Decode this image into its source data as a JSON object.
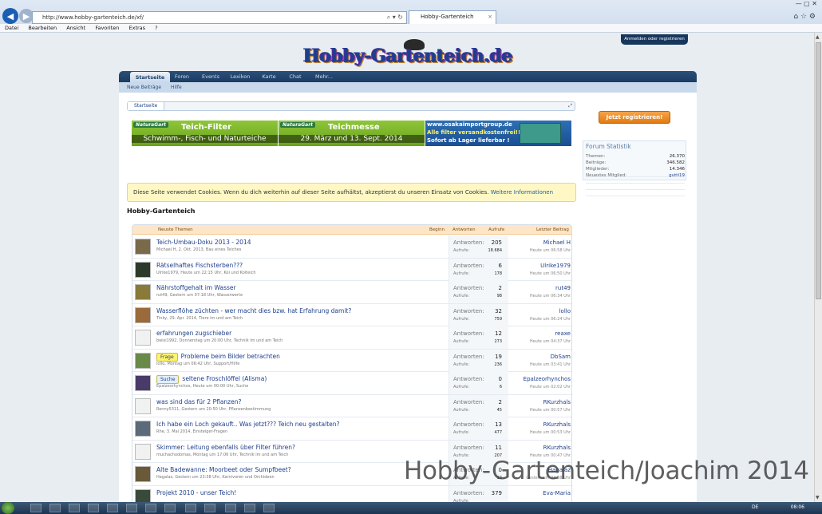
{
  "browser": {
    "url": "http://www.hobby-gartenteich.de/xf/",
    "tab_title": "Hobby-Gartenteich",
    "tab_close": "×",
    "menu": [
      "Datei",
      "Bearbeiten",
      "Ansicht",
      "Favoriten",
      "Extras",
      "?"
    ]
  },
  "site": {
    "logo": "Hobby-Gartenteich.de",
    "login": "Anmelden oder registrieren",
    "nav": [
      "Startseite",
      "Foren",
      "Events",
      "Lexikon",
      "Karte",
      "Chat",
      "Mehr..."
    ],
    "subnav": [
      "Neue Beiträge",
      "Hilfe"
    ],
    "breadcrumb": "Startseite"
  },
  "ads": {
    "ad1": {
      "tag": "NaturaGart",
      "headline": "Teich-Filter",
      "sub": "Schwimm-, Fisch- und Naturteiche"
    },
    "ad2": {
      "tag": "NaturaGart",
      "headline": "Teichmesse",
      "sub": "29. März und 13. Sept. 2014"
    },
    "ad3": {
      "l1": "www.osakaimportgroup.de",
      "l2": "Alle filter versandkostenfrei!!",
      "l3": "Sofort ab Lager lieferbar !"
    }
  },
  "sidebar": {
    "register": "Jetzt registrieren!",
    "stats_title": "Forum Statistik",
    "stats": [
      {
        "label": "Themen:",
        "value": "26.370"
      },
      {
        "label": "Beiträge:",
        "value": "346.582"
      },
      {
        "label": "Mitglieder:",
        "value": "14.346"
      },
      {
        "label": "Neuestes Mitglied:",
        "value": "gutti19"
      }
    ]
  },
  "cookie": {
    "text": "Diese Seite verwendet Cookies. Wenn du dich weiterhin auf dieser Seite aufhältst, akzeptierst du unseren Einsatz von Cookies.",
    "link": "Weitere Informationen"
  },
  "section_title": "Hobby-Gartenteich",
  "table": {
    "headers": {
      "topics": "Neuste Themen",
      "start": "Beginn",
      "replies": "Antworten",
      "views": "Aufrufe",
      "last": "Letzter Beitrag"
    },
    "answers_label": "Antworten:",
    "views_label": "Aufrufe:",
    "rows": [
      {
        "title": "Teich-Umbau-Doku 2013 - 2014",
        "prefix": "",
        "meta": "Michael H, 2. Okt. 2013, Bau eines Teiches",
        "answers": "205",
        "views": "18.684",
        "last_user": "Michael H",
        "last_time": "Heute um 06:58 Uhr"
      },
      {
        "title": "Rätselhaftes Fischsterben???",
        "prefix": "",
        "meta": "Ulrike1979, Heute um 22:15 Uhr, Koi und Koiteich",
        "answers": "6",
        "views": "178",
        "last_user": "Ulrike1979",
        "last_time": "Heute um 06:50 Uhr"
      },
      {
        "title": "Nährstoffgehalt im Wasser",
        "prefix": "",
        "meta": "rut49, Gestern um 07:18 Uhr, Wasserwerte",
        "answers": "2",
        "views": "98",
        "last_user": "rut49",
        "last_time": "Heute um 06:34 Uhr"
      },
      {
        "title": "Wasserflöhe züchten - wer macht dies bzw. hat Erfahrung damit?",
        "prefix": "",
        "meta": "Tinky, 29. Apr. 2014, Tiere im und am Teich",
        "answers": "32",
        "views": "759",
        "last_user": "lollo",
        "last_time": "Heute um 06:24 Uhr"
      },
      {
        "title": "erfahrungen zugschieber",
        "prefix": "",
        "meta": "bwisi1992, Donnerstag um 20:00 Uhr, Technik im und am Teich",
        "answers": "12",
        "views": "273",
        "last_user": "reaxe",
        "last_time": "Heute um 04:37 Uhr"
      },
      {
        "title": "Probleme beim Bilder betrachten",
        "prefix": "Frage",
        "meta": "lollo, Montag um 06:42 Uhr, Support/Hilfe",
        "answers": "19",
        "views": "236",
        "last_user": "DbSam",
        "last_time": "Heute um 03:41 Uhr"
      },
      {
        "title": "seltene Froschlöffel (Alisma)",
        "prefix": "Suche",
        "meta": "Epalzeorhynchos, Heute um 00:00 Uhr, Suche",
        "answers": "0",
        "views": "6",
        "last_user": "Epalzeorhynchos",
        "last_time": "Heute um 02:02 Uhr"
      },
      {
        "title": "was sind das für 2 Pflanzen?",
        "prefix": "",
        "meta": "Ronny5311, Gestern um 20:50 Uhr, Pflanzenbestimmung",
        "answers": "2",
        "views": "45",
        "last_user": "RKurzhals",
        "last_time": "Heute um 00:57 Uhr"
      },
      {
        "title": "Ich habe ein Loch gekauft.. Was jetzt??? Teich neu gestalten?",
        "prefix": "",
        "meta": "Rhe, 3. Mai 2014, Einsteiger-Fragen",
        "answers": "13",
        "views": "477",
        "last_user": "RKurzhals",
        "last_time": "Heute um 00:53 Uhr"
      },
      {
        "title": "Skimmer: Leitung ebenfalls über Filter führen?",
        "prefix": "",
        "meta": "muchachodomas, Montag um 17:06 Uhr, Technik im und am Teich",
        "answers": "11",
        "views": "207",
        "last_user": "RKurzhals",
        "last_time": "Heute um 00:47 Uhr"
      },
      {
        "title": "Alte Badewanne: Moorbeet oder Sumpfbeet?",
        "prefix": "",
        "meta": "Hagalaz, Gestern um 23:38 Uhr, Karnivoren und Orchideen",
        "answers": "0",
        "views": "12",
        "last_user": "Hagalaz",
        "last_time": "Gestern um 23:38 Uhr"
      },
      {
        "title": "Projekt 2010 - unser Teich!",
        "prefix": "",
        "meta": "",
        "answers": "379",
        "views": "",
        "last_user": "Eva-Maria",
        "last_time": ""
      }
    ]
  },
  "taskbar": {
    "lang": "DE",
    "clock": "08:06"
  },
  "watermark": "Hobby-Gartenteich/Joachim 2014",
  "colors": {
    "nav": "#1c3c62",
    "accent": "#e07a12",
    "link": "#1d3f8c"
  }
}
